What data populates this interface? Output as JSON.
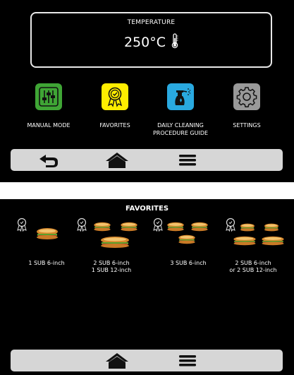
{
  "home_screen": {
    "temperature": {
      "label": "TEMPERATURE",
      "value": "250°C"
    },
    "tiles": [
      {
        "label": "MANUAL\nMODE",
        "icon": "sliders-icon",
        "color": "#3fa535"
      },
      {
        "label": "FAVORITES",
        "icon": "award-ribbon-icon",
        "color": "#ffee00"
      },
      {
        "label": "DAILY CLEANING\nPROCEDURE GUIDE",
        "icon": "spray-bottle-icon",
        "color": "#29a9e0"
      },
      {
        "label": "SETTINGS",
        "icon": "gear-icon",
        "color": "#999999"
      }
    ],
    "navbar": [
      "back-arrow-icon",
      "home-icon",
      "menu-icon"
    ]
  },
  "favorites_screen": {
    "title": "FAVORITES",
    "items": [
      {
        "label": "1 SUB 6-inch",
        "icon": "award-ribbon-icon"
      },
      {
        "label": "2 SUB 6-inch\n1 SUB 12-inch",
        "icon": "award-ribbon-icon"
      },
      {
        "label": "3 SUB 6-inch",
        "icon": "award-ribbon-icon"
      },
      {
        "label": "2 SUB 6-inch\nor 2 SUB 12-inch",
        "icon": "award-ribbon-icon"
      }
    ],
    "navbar": [
      "home-icon",
      "menu-icon"
    ]
  }
}
